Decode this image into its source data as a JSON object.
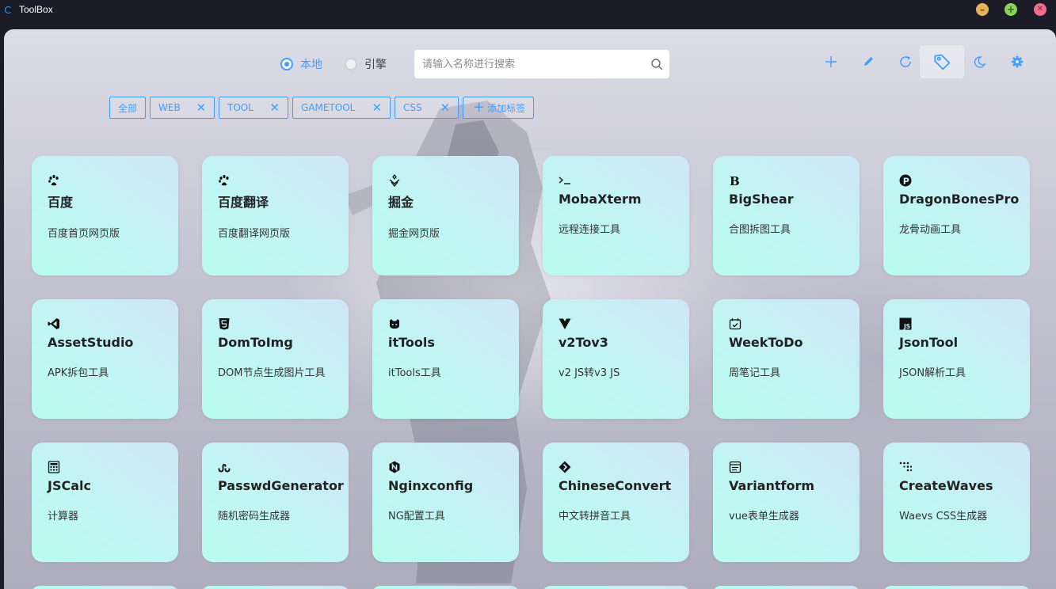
{
  "window": {
    "title": "ToolBox"
  },
  "search": {
    "modes": [
      {
        "label": "本地",
        "checked": true
      },
      {
        "label": "引擎",
        "checked": false
      }
    ],
    "placeholder": "请输入名称进行搜索",
    "value": ""
  },
  "toolbar": {
    "buttons": [
      {
        "name": "add",
        "icon": "plus-icon"
      },
      {
        "name": "edit",
        "icon": "pencil-icon"
      },
      {
        "name": "refresh",
        "icon": "refresh-icon"
      },
      {
        "name": "tags",
        "icon": "tag-icon",
        "active": true
      },
      {
        "name": "theme",
        "icon": "moon-icon"
      },
      {
        "name": "settings",
        "icon": "gear-icon"
      }
    ]
  },
  "tags": {
    "items": [
      {
        "label": "全部",
        "closable": false
      },
      {
        "label": "WEB",
        "closable": true
      },
      {
        "label": "TOOL",
        "closable": true
      },
      {
        "label": "GAMETOOL",
        "closable": true
      },
      {
        "label": "CSS",
        "closable": true
      }
    ],
    "add_label": "添加标签"
  },
  "tools": [
    {
      "name": "百度",
      "desc": "百度首页网页版",
      "icon": "paw-icon"
    },
    {
      "name": "百度翻译",
      "desc": "百度翻译网页版",
      "icon": "paw-icon"
    },
    {
      "name": "掘金",
      "desc": "掘金网页版",
      "icon": "juejin-icon"
    },
    {
      "name": "MobaXterm",
      "desc": "远程连接工具",
      "icon": "terminal-icon"
    },
    {
      "name": "BigShear",
      "desc": "合图拆图工具",
      "icon": "b-letter-icon"
    },
    {
      "name": "DragonBonesPro",
      "desc": "龙骨动画工具",
      "icon": "p-circle-icon"
    },
    {
      "name": "AssetStudio",
      "desc": "APK拆包工具",
      "icon": "vscode-icon"
    },
    {
      "name": "DomToImg",
      "desc": "DOM节点生成图片工具",
      "icon": "html5-icon"
    },
    {
      "name": "itTools",
      "desc": "itTools工具",
      "icon": "github-cat-icon"
    },
    {
      "name": "v2Tov3",
      "desc": "v2 JS转v3 JS",
      "icon": "vue-icon"
    },
    {
      "name": "WeekToDo",
      "desc": "周笔记工具",
      "icon": "calendar-check-icon"
    },
    {
      "name": "JsonTool",
      "desc": "JSON解析工具",
      "icon": "js-icon"
    },
    {
      "name": "JSCalc",
      "desc": "计算器",
      "icon": "calculator-icon"
    },
    {
      "name": "PasswdGenerator",
      "desc": "随机密码生成器",
      "icon": "stumbleupon-icon"
    },
    {
      "name": "Nginxconfig",
      "desc": "NG配置工具",
      "icon": "nginx-icon"
    },
    {
      "name": "ChineseConvert",
      "desc": "中文转拼音工具",
      "icon": "diamond-arrow-icon"
    },
    {
      "name": "Variantform",
      "desc": "vue表单生成器",
      "icon": "form-icon"
    },
    {
      "name": "CreateWaves",
      "desc": "Waevs CSS生成器",
      "icon": "dots-icon"
    }
  ],
  "colors": {
    "accent": "#409eff",
    "titlebar": "#1c1c28",
    "card_from": "#b9fcf0",
    "card_to": "#cfe6f7"
  }
}
